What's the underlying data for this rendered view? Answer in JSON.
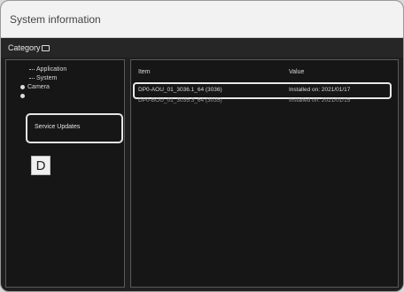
{
  "window": {
    "title": "System information"
  },
  "category": {
    "label": "Category"
  },
  "tree": {
    "items": [
      {
        "label": "Application"
      },
      {
        "label": "System"
      },
      {
        "label": "Camera"
      },
      {
        "label": "Service Updates"
      }
    ]
  },
  "marker": {
    "label": "D"
  },
  "table": {
    "headers": {
      "name": "Item",
      "value": "Value"
    },
    "rows": [
      {
        "name": "DP0-AOU_01_3036.1_64 (3036)",
        "value": "Installed on: 2021/01/17"
      },
      {
        "name": "DP0-BOU_01_3035.3_64 (3035)",
        "value": "Installed on: 2021/01/15"
      }
    ]
  },
  "colors": {
    "background": "#1f1f1f",
    "titlebar": "#f2f2f2",
    "highlight_border": "#e8e8e8"
  }
}
